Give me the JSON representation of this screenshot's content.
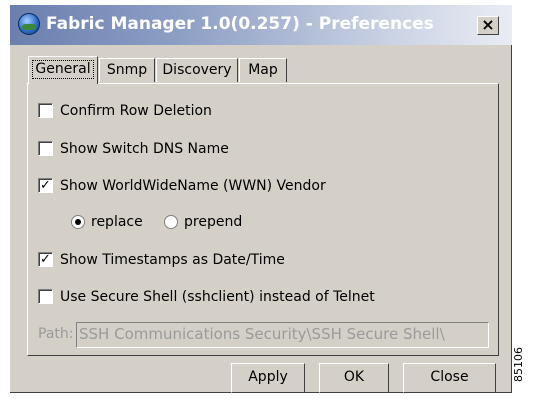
{
  "window": {
    "title": "Fabric Manager 1.0(0.257) - Preferences",
    "close_glyph": "×",
    "app_icon": "fabric-manager-globe-icon"
  },
  "tabs": [
    {
      "label": "General",
      "active": true
    },
    {
      "label": "Snmp",
      "active": false
    },
    {
      "label": "Discovery",
      "active": false
    },
    {
      "label": "Map",
      "active": false
    }
  ],
  "general": {
    "options": [
      {
        "label": "Confirm Row Deletion",
        "checked": false
      },
      {
        "label": "Show Switch DNS Name",
        "checked": false
      },
      {
        "label": "Show WorldWideName (WWN) Vendor",
        "checked": true
      },
      {
        "label": "Show Timestamps as Date/Time",
        "checked": true
      },
      {
        "label": "Use Secure Shell (sshclient) instead of Telnet",
        "checked": false
      }
    ],
    "wwn_mode": {
      "replace_label": "replace",
      "prepend_label": "prepend",
      "selected": "replace"
    },
    "path": {
      "label": "Path:",
      "value": "SSH Communications Security\\SSH Secure Shell\\",
      "disabled": true
    }
  },
  "buttons": {
    "apply": "Apply",
    "ok": "OK",
    "close": "Close"
  },
  "figure_id": "85106",
  "colors": {
    "face": "#d4d0c8",
    "title_start": "#6b7fae",
    "title_end": "#e9ecf3",
    "disabled_text": "#9a9a9a"
  }
}
